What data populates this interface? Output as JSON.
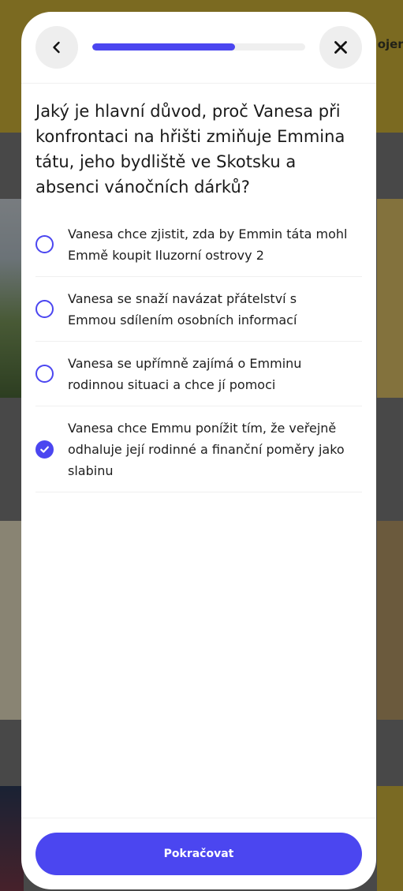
{
  "background": {
    "header_text": "ojen"
  },
  "quiz": {
    "progress_fraction": 0.67,
    "question": "Jaký je hlavní důvod, proč Vanesa při konfrontaci na hřišti zmiňuje Emmina tátu, jeho bydliště ve Skotsku a absenci vánočních dárků?",
    "options": [
      {
        "label": "Vanesa chce zjistit, zda by Emmin táta mohl Emmě koupit Iluzorní ostrovy 2",
        "selected": false
      },
      {
        "label": "Vanesa se snaží navázat přátelství s Emmou sdílením osobních informací",
        "selected": false
      },
      {
        "label": "Vanesa se upřímně zajímá o Emminu rodinnou situaci a chce jí pomoci",
        "selected": false
      },
      {
        "label": "Vanesa chce Emmu ponížit tím, že veřejně odhaluje její rodinné a finanční poměry jako slabinu",
        "selected": true
      }
    ],
    "continue_label": "Pokračovat"
  },
  "icons": {
    "back": "chevron-left-icon",
    "close": "close-icon",
    "check": "check-icon"
  },
  "colors": {
    "accent": "#4b46f0",
    "header_yellow": "#d4b73a"
  }
}
